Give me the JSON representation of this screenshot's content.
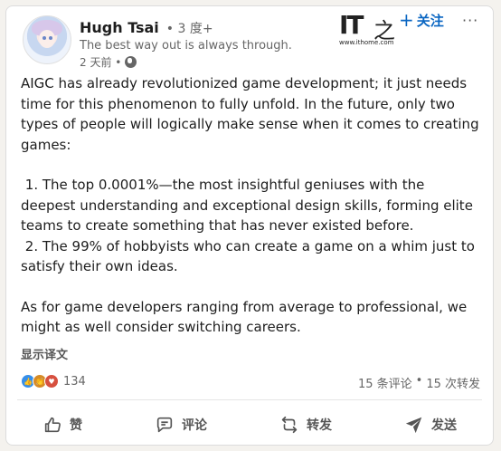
{
  "author": {
    "name": "Hugh Tsai",
    "degree": "• 3 度+",
    "tagline": "The best way out is always through.",
    "time": "2 天前 •"
  },
  "header": {
    "watermark_logo": "IT之家",
    "watermark_url": "www.ithome.com",
    "follow_label": "关注",
    "more_label": "···"
  },
  "post": {
    "paragraphs": [
      "AIGC has already revolutionized game development; it just needs time for this phenomenon to fully unfold. In the future, only two types of people will logically make sense when it comes to creating games:",
      " 1. The top 0.0001%—the most insightful geniuses with the deepest understanding and exceptional design skills, forming elite teams to create something that has never existed before.\n 2. The 99% of hobbyists who can create a game on a whim just to satisfy their own ideas.",
      "As for game developers ranging from average to professional, we might as well consider switching careers."
    ],
    "translate_label": "显示译文"
  },
  "engagement": {
    "reaction_count": "134",
    "comments": "15 条评论",
    "separator": "•",
    "reposts": "15 次转发"
  },
  "actions": {
    "like": "赞",
    "comment": "评论",
    "repost": "转发",
    "send": "发送"
  },
  "colors": {
    "accent": "#0a66c2",
    "like_reaction": "#378fe9",
    "celebrate_reaction": "#d68b26",
    "love_reaction": "#d7503f"
  },
  "icons": [
    "globe-icon",
    "plus-icon",
    "more-icon",
    "like-icon",
    "comment-icon",
    "repost-icon",
    "send-icon"
  ]
}
